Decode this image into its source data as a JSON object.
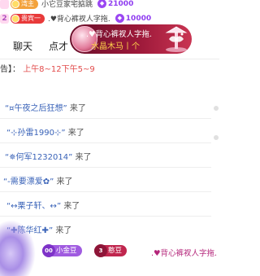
{
  "rank_rows": [
    {
      "rank": "",
      "badge_text": "湾主",
      "badge_color": "#f3a23b",
      "name": "小它豆家宅掂跳",
      "coin_icon": "diamond-coin-icon",
      "amount": "21000"
    },
    {
      "rank": "2",
      "badge_text": "贵宾一",
      "badge_color": "#e83a3a",
      "name": ".♥背心裤衩人字拖.",
      "coin_icon": "diamond-coin-icon",
      "amount": "10000"
    }
  ],
  "tabs": [
    {
      "label": "聊天"
    },
    {
      "label": "点才"
    }
  ],
  "gift_banner": {
    "sender": ".♥背心裤衩人字拖.",
    "gift_text": "水晶木马丨个",
    "colors": {
      "bg_start": "#6a0f2a",
      "bg_end": "#c93452",
      "gift_text": "#ffd24a"
    }
  },
  "schedule": {
    "prefix": "告】：",
    "times": "上午8~12下午5~9",
    "time_color": "#e24c4c"
  },
  "entry_feed": [
    {
      "user": "“¤午夜之后狂想”",
      "action": "来了"
    },
    {
      "user": "“⊹孙雷1990⊹”",
      "action": "来了"
    },
    {
      "user": "“✵何军1232014”",
      "action": "来了"
    },
    {
      "user": "“-需要漂爱✿”",
      "action": "来了"
    },
    {
      "user": "“↔栗子轩、↔”",
      "action": "来了"
    },
    {
      "user": "“✚陈华红✚”",
      "action": "来了"
    }
  ],
  "bottom_entry": {
    "badge1_level": "00",
    "badge1_text": "小金豆",
    "badge1_color": "#a05be0",
    "badge2_level": "3",
    "badge2_text": "憨豆",
    "badge2_color": "#c0264e",
    "name": ".♥背心裤衩人字拖."
  }
}
